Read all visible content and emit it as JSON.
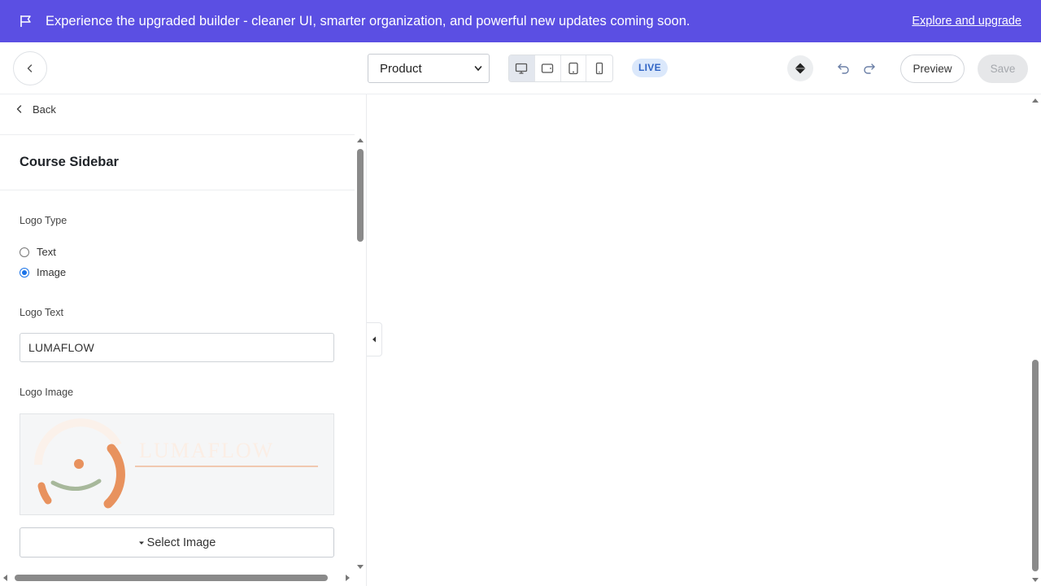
{
  "banner": {
    "message": "Experience the upgraded builder - cleaner UI, smarter organization, and powerful new updates coming soon.",
    "cta": "Explore and upgrade",
    "icon": "flag-icon",
    "background": "#5b4fe3"
  },
  "toolbar": {
    "page_select_value": "Product",
    "devices": [
      "desktop",
      "tablet-landscape",
      "tablet-portrait",
      "mobile"
    ],
    "active_device": "desktop",
    "status_badge": "LIVE",
    "preview_label": "Preview",
    "save_label": "Save"
  },
  "panel": {
    "back_label": "Back",
    "title": "Course Sidebar",
    "logo_type_label": "Logo Type",
    "logo_type_options": [
      "Text",
      "Image"
    ],
    "logo_type_selected": "Image",
    "logo_text_label": "Logo Text",
    "logo_text_value": "LUMAFLOW",
    "logo_image_label": "Logo Image",
    "select_image_label": "Select Image"
  },
  "colors": {
    "accent": "#5b4fe3",
    "live_badge_bg": "#dbe8fb",
    "live_badge_text": "#2f63c4",
    "radio_checked": "#1a73e8",
    "logo_orange": "#e8925e",
    "logo_green": "#a7b89b"
  }
}
